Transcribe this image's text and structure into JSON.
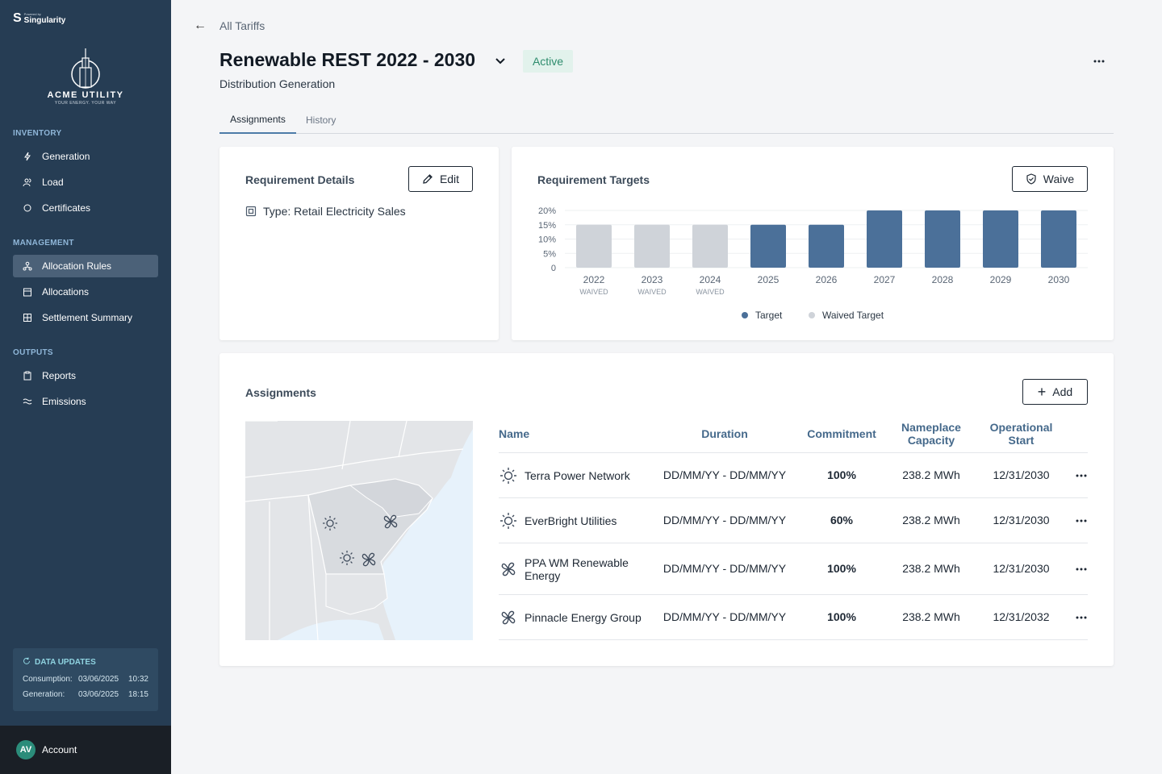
{
  "brand": {
    "powered_by": "Powered by",
    "name": "Singularity"
  },
  "org": {
    "name": "ACME UTILITY",
    "tagline": "YOUR ENERGY. YOUR WAY"
  },
  "sidebar": {
    "sections": [
      {
        "label": "INVENTORY",
        "items": [
          {
            "label": "Generation",
            "icon": "lightning-icon"
          },
          {
            "label": "Load",
            "icon": "users-icon"
          },
          {
            "label": "Certificates",
            "icon": "certificate-icon"
          }
        ]
      },
      {
        "label": "MANAGEMENT",
        "items": [
          {
            "label": "Allocation Rules",
            "icon": "network-icon",
            "active": true
          },
          {
            "label": "Allocations",
            "icon": "calendar-icon"
          },
          {
            "label": "Settlement Summary",
            "icon": "grid-icon"
          }
        ]
      },
      {
        "label": "OUTPUTS",
        "items": [
          {
            "label": "Reports",
            "icon": "clipboard-icon"
          },
          {
            "label": "Emissions",
            "icon": "waves-icon"
          }
        ]
      }
    ],
    "data_updates": {
      "title": "DATA UPDATES",
      "rows": [
        {
          "label": "Consumption:",
          "date": "03/06/2025",
          "time": "10:32"
        },
        {
          "label": "Generation:",
          "date": "03/06/2025",
          "time": "18:15"
        }
      ]
    },
    "account": {
      "initials": "AV",
      "label": "Account"
    }
  },
  "header": {
    "back_label": "All Tariffs",
    "title": "Renewable REST 2022 - 2030",
    "status": "Active",
    "subtitle": "Distribution Generation"
  },
  "tabs": [
    {
      "label": "Assignments",
      "active": true
    },
    {
      "label": "History",
      "active": false
    }
  ],
  "requirement_details": {
    "title": "Requirement Details",
    "edit_label": "Edit",
    "type_text": "Type: Retail Electricity Sales"
  },
  "requirement_targets": {
    "title": "Requirement Targets",
    "waive_label": "Waive",
    "colors": {
      "target": "#4b7099",
      "waived": "#cfd3d9"
    }
  },
  "chart_data": {
    "type": "bar",
    "categories": [
      "2022",
      "2023",
      "2024",
      "2025",
      "2026",
      "2027",
      "2028",
      "2029",
      "2030"
    ],
    "sublabels": [
      "WAIVED",
      "WAIVED",
      "WAIVED",
      "",
      "",
      "",
      "",
      "",
      ""
    ],
    "values": [
      15,
      15,
      15,
      15,
      15,
      20,
      20,
      20,
      20
    ],
    "waived": [
      true,
      true,
      true,
      false,
      false,
      false,
      false,
      false,
      false
    ],
    "yticks": [
      "0",
      "5%",
      "10%",
      "15%",
      "20%"
    ],
    "ylim": [
      0,
      20
    ],
    "legend": [
      "Target",
      "Waived Target"
    ],
    "legend_position": "bottom"
  },
  "assignments": {
    "title": "Assignments",
    "add_label": "Add",
    "columns": [
      "Name",
      "Duration",
      "Commitment",
      "Nameplace Capacity",
      "Operational Start"
    ],
    "rows": [
      {
        "icon": "sun-icon",
        "name": "Terra Power Network",
        "duration": "DD/MM/YY - DD/MM/YY",
        "commitment": "100%",
        "capacity": "238.2 MWh",
        "start": "12/31/2030"
      },
      {
        "icon": "sun-icon",
        "name": "EverBright Utilities",
        "duration": "DD/MM/YY - DD/MM/YY",
        "commitment": "60%",
        "capacity": "238.2 MWh",
        "start": "12/31/2030"
      },
      {
        "icon": "wind-icon",
        "name": "PPA WM Renewable Energy",
        "duration": "DD/MM/YY - DD/MM/YY",
        "commitment": "100%",
        "capacity": "238.2 MWh",
        "start": "12/31/2030"
      },
      {
        "icon": "wind-icon",
        "name": "Pinnacle Energy Group",
        "duration": "DD/MM/YY - DD/MM/YY",
        "commitment": "100%",
        "capacity": "238.2 MWh",
        "start": "12/31/2032"
      }
    ]
  }
}
